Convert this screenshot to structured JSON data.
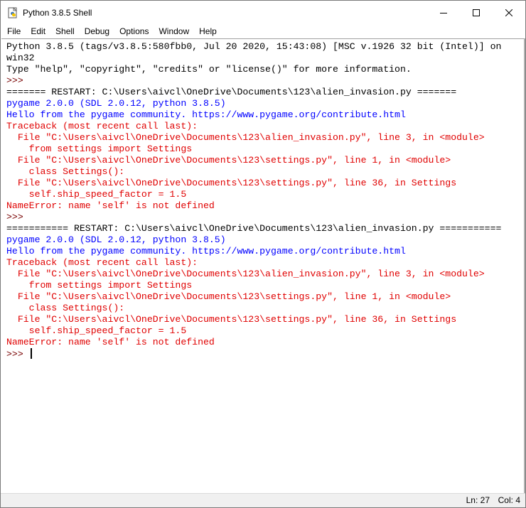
{
  "window": {
    "title": "Python 3.8.5 Shell",
    "icon": "python-idle-icon",
    "controls": {
      "minimize": "minimize-icon",
      "maximize": "maximize-icon",
      "close": "close-icon"
    }
  },
  "menubar": {
    "items": [
      "File",
      "Edit",
      "Shell",
      "Debug",
      "Options",
      "Window",
      "Help"
    ]
  },
  "shell": {
    "colors": {
      "stdout": "#000000",
      "prompt": "#770000",
      "stderr": "#e00000",
      "pygame_output": "#0000ff"
    },
    "lines": [
      {
        "text": "Python 3.8.5 (tags/v3.8.5:580fbb0, Jul 20 2020, 15:43:08) [MSC v.1926 32 bit (Intel)] on",
        "style": "stdout"
      },
      {
        "text": "win32",
        "style": "stdout"
      },
      {
        "text": "Type \"help\", \"copyright\", \"credits\" or \"license()\" for more information.",
        "style": "stdout"
      },
      {
        "text": ">>> ",
        "style": "prompt"
      },
      {
        "text": "======= RESTART: C:\\Users\\aivcl\\OneDrive\\Documents\\123\\alien_invasion.py =======",
        "style": "stdout"
      },
      {
        "text": "pygame 2.0.0 (SDL 2.0.12, python 3.8.5)",
        "style": "blue"
      },
      {
        "text": "Hello from the pygame community. https://www.pygame.org/contribute.html",
        "style": "blue"
      },
      {
        "text": "Traceback (most recent call last):",
        "style": "stderr"
      },
      {
        "text": "  File \"C:\\Users\\aivcl\\OneDrive\\Documents\\123\\alien_invasion.py\", line 3, in <module>",
        "style": "stderr"
      },
      {
        "text": "    from settings import Settings",
        "style": "stderr"
      },
      {
        "text": "  File \"C:\\Users\\aivcl\\OneDrive\\Documents\\123\\settings.py\", line 1, in <module>",
        "style": "stderr"
      },
      {
        "text": "    class Settings():",
        "style": "stderr"
      },
      {
        "text": "  File \"C:\\Users\\aivcl\\OneDrive\\Documents\\123\\settings.py\", line 36, in Settings",
        "style": "stderr"
      },
      {
        "text": "    self.ship_speed_factor = 1.5",
        "style": "stderr"
      },
      {
        "text": "NameError: name 'self' is not defined",
        "style": "stderr"
      },
      {
        "text": ">>> ",
        "style": "prompt"
      },
      {
        "text": "=========== RESTART: C:\\Users\\aivcl\\OneDrive\\Documents\\123\\alien_invasion.py ===========",
        "style": "stdout"
      },
      {
        "text": "pygame 2.0.0 (SDL 2.0.12, python 3.8.5)",
        "style": "blue"
      },
      {
        "text": "Hello from the pygame community. https://www.pygame.org/contribute.html",
        "style": "blue"
      },
      {
        "text": "Traceback (most recent call last):",
        "style": "stderr"
      },
      {
        "text": "  File \"C:\\Users\\aivcl\\OneDrive\\Documents\\123\\alien_invasion.py\", line 3, in <module>",
        "style": "stderr"
      },
      {
        "text": "    from settings import Settings",
        "style": "stderr"
      },
      {
        "text": "  File \"C:\\Users\\aivcl\\OneDrive\\Documents\\123\\settings.py\", line 1, in <module>",
        "style": "stderr"
      },
      {
        "text": "    class Settings():",
        "style": "stderr"
      },
      {
        "text": "  File \"C:\\Users\\aivcl\\OneDrive\\Documents\\123\\settings.py\", line 36, in Settings",
        "style": "stderr"
      },
      {
        "text": "    self.ship_speed_factor = 1.5",
        "style": "stderr"
      },
      {
        "text": "NameError: name 'self' is not defined",
        "style": "stderr"
      }
    ],
    "current_prompt": ">>> "
  },
  "statusbar": {
    "ln": "Ln: 27",
    "col": "Col: 4"
  }
}
